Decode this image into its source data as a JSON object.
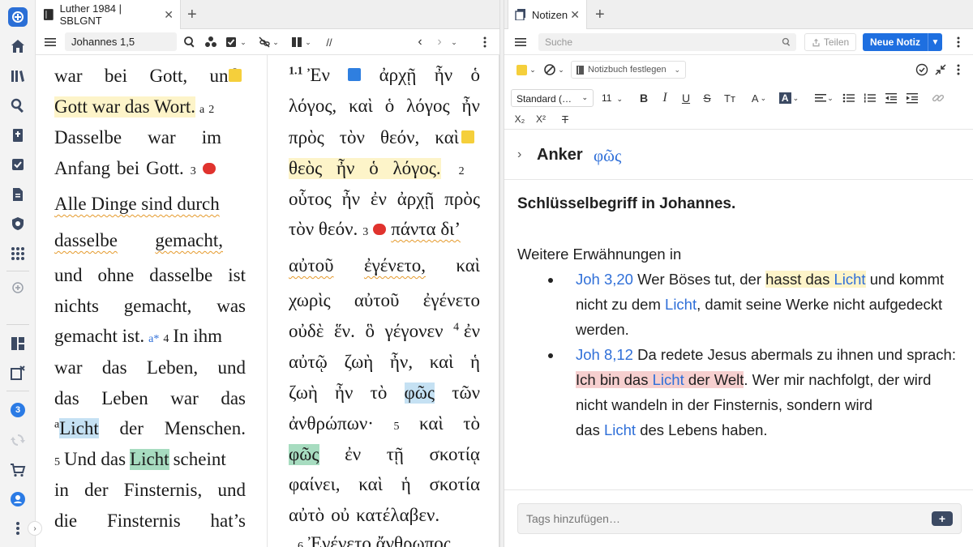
{
  "left_tab": {
    "title": "Luther 1984 | SBLGNT",
    "close": "✕",
    "add": "+"
  },
  "right_tab": {
    "title": "Notizen",
    "close": "✕",
    "add": "+"
  },
  "bible_toolbar": {
    "reference": "Johannes 1,5",
    "sync_label": "//"
  },
  "luther": {
    "l1": [
      "war",
      "bei",
      "Gott,",
      "und"
    ],
    "l2_hl": "Gott war das Wort.",
    "l2_sup": "a",
    "l2_vnum": "2",
    "l3": [
      "Dasselbe",
      "war",
      "im"
    ],
    "l4": [
      "Anfang",
      "bei",
      "Gott."
    ],
    "l4_vnum": "3",
    "l5": "Alle Dinge sind durch",
    "l6": [
      "dasselbe",
      "gemacht,"
    ],
    "l7": [
      "und",
      "ohne",
      "dasselbe",
      "ist"
    ],
    "l8": [
      "nichts",
      "gemacht,",
      "was"
    ],
    "l9a": "gemacht ist.",
    "l9_sup": "a*",
    "l9_vnum": "4",
    "l9b": "In ihm",
    "l10": [
      "war",
      "das",
      "Leben,",
      "und"
    ],
    "l11": [
      "das",
      "Leben",
      "war",
      "das"
    ],
    "l12_sup": "a",
    "l12_hl": "Licht",
    "l12_rest": [
      "der",
      "Menschen."
    ],
    "l13_vnum": "5",
    "l13a": "Und das",
    "l13_hl": "Licht",
    "l13b": "scheint",
    "l14": [
      "in",
      "der",
      "Finsternis,",
      "und"
    ],
    "l15": [
      "die",
      "Finsternis",
      "hat’s"
    ]
  },
  "greek": {
    "g1_vnum": "1.1",
    "g1": [
      "Ἐν",
      "ἀρχῇ",
      "ἦν",
      "ὁ"
    ],
    "g2": [
      "λόγος,",
      "καὶ",
      "ὁ",
      "λόγος",
      "ἦν"
    ],
    "g3": [
      "πρὸς",
      "τὸν",
      "θεόν,",
      "καὶ"
    ],
    "g4_hl": "θεὸς ἦν ὁ λόγος.",
    "g4_vnum": "2",
    "g5": [
      "οὗτος",
      "ἦν",
      "ἐν",
      "ἀρχῇ",
      "πρὸς"
    ],
    "g6": "τὸν θεόν.",
    "g6_vnum": "3",
    "g6_wavy": "πάντα δι’",
    "g7": [
      "αὐτοῦ",
      "ἐγένετο,",
      "καὶ"
    ],
    "g8": [
      "χωρὶς",
      "αὐτοῦ",
      "ἐγένετο"
    ],
    "g9": [
      "οὐδὲ",
      "ἕν.",
      "ὃ",
      "γέγονεν"
    ],
    "g9_vnum": "4",
    "g9_end": "ἐν",
    "g10": [
      "αὐτῷ",
      "ζωὴ",
      "ἦν,",
      "καὶ",
      "ἡ"
    ],
    "g11a": [
      "ζωὴ",
      "ἦν",
      "τὸ"
    ],
    "g11_hl": "φῶς",
    "g11b": "τῶν",
    "g12": "ἀνθρώπων·",
    "g12_vnum": "5",
    "g12_rest": [
      "καὶ",
      "τὸ"
    ],
    "g13_hl": "φῶς",
    "g13_rest": [
      "ἐν",
      "τῇ",
      "σκοτίᾳ"
    ],
    "g14": [
      "φαίνει,",
      "καὶ",
      "ἡ",
      "σκοτία"
    ],
    "g15": [
      "αὐτὸ",
      "οὐ",
      "κατέλαβεν."
    ],
    "g16_vnum": "6",
    "g16": "Ἐγένετο ἄνθρωπος"
  },
  "notes_toolbar": {
    "search_placeholder": "Suche",
    "share_label": "Teilen",
    "new_note_label": "Neue Notiz",
    "notebook_label": "Notizbuch festlegen",
    "style_select": "Standard (…",
    "size_select": "11"
  },
  "anchor": {
    "label": "Anker",
    "word": "φῶς"
  },
  "note": {
    "heading": "Schlüsselbegriff in Johannes.",
    "intro": "Weitere Erwähnungen in",
    "b1_ref": "Joh 3,20",
    "b1_t1": "Wer Böses tut, der",
    "b1_hl1": "hasst das",
    "b1_hl_link": "Licht",
    "b1_t2": "und kommt",
    "b1_l2a": "nicht zu dem",
    "b1_l2_link": "Licht",
    "b1_l2b": ", damit seine Werke nicht aufgedeckt",
    "b1_l3": "werden.",
    "b2_ref": "Joh 8,12",
    "b2_t1": "Da redete Jesus abermals zu ihnen und sprach:",
    "b2_hl1": "Ich bin das",
    "b2_hl_link": "Licht",
    "b2_hl2": "der Welt",
    "b2_t2": ". Wer mir nachfolgt, der wird",
    "b2_l3": "nicht wandeln in der Finsternis, sondern wird",
    "b2_l4a": "das",
    "b2_l4_link": "Licht",
    "b2_l4b": "des Lebens haben."
  },
  "tags": {
    "placeholder": "Tags hinzufügen…"
  },
  "rail": {
    "badge_count": "3"
  }
}
